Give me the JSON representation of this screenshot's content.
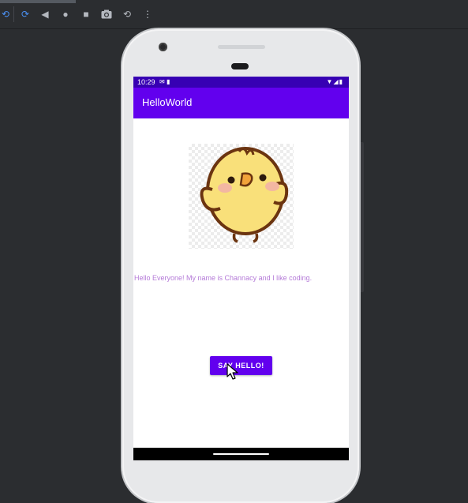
{
  "toolbar": {
    "icons": [
      "rotate-left-icon",
      "rotate-right-icon",
      "back-icon",
      "home-icon",
      "overview-icon",
      "screenshot-icon",
      "snapshot-icon",
      "more-icon"
    ]
  },
  "status_bar": {
    "time": "10:29",
    "left_icons": [
      "notification-icon",
      "sim-card-icon"
    ],
    "right_icons": [
      "wifi-icon",
      "signal-icon",
      "battery-icon"
    ]
  },
  "app": {
    "title": "HelloWorld",
    "image": "chick-image",
    "hello_text": "Hello Everyone! My name is Channacy and I like coding.",
    "button_label": "SAY HELLO!"
  },
  "colors": {
    "primary": "#6200ee",
    "primary_dark": "#3700b3",
    "text_accent": "#b57bd8",
    "emulator_bg": "#2b2d30"
  }
}
